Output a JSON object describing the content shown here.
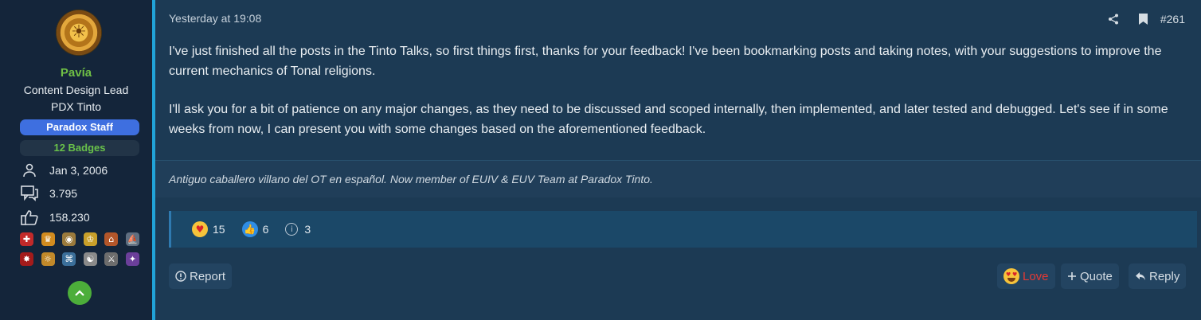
{
  "user": {
    "name": "Pavía",
    "title_line1": "Content Design Lead",
    "title_line2": "PDX Tinto",
    "staff_badge": "Paradox Staff",
    "badges": "12 Badges",
    "stats": [
      {
        "icon": "person-icon",
        "value": "Jan 3, 2006"
      },
      {
        "icon": "messages-icon",
        "value": "3.795"
      },
      {
        "icon": "thumbs-up-icon",
        "value": "158.230"
      }
    ],
    "trophy_icons": [
      "crusader-shield-icon",
      "crown-gold-icon",
      "coin-seal-icon",
      "crowns-icon",
      "castle-icon",
      "ship-icon",
      "dragon-icon",
      "sun-seal-icon",
      "temple-icon",
      "yin-yang-icon",
      "sword-icon",
      "dark-sigil-icon"
    ]
  },
  "post": {
    "date": "Yesterday at 19:08",
    "number": "#261",
    "paragraphs": [
      "I've just finished all the posts in the Tinto Talks, so first things first, thanks for your feedback! I've been bookmarking posts and taking notes, with your suggestions to improve the current mechanics of Tonal religions.",
      "I'll ask you for a bit of patience on any major changes, as they need to be discussed and scoped internally, then implemented, and later tested and debugged. Let's see if in some weeks from now, I can present you with some changes based on the aforementioned feedback."
    ],
    "signature": "Antiguo caballero villano del OT en español. Now member of EUIV & EUV Team at Paradox Tinto."
  },
  "reactions": [
    {
      "icon": "love-emoji-icon",
      "count": "15"
    },
    {
      "icon": "like-icon",
      "count": "6"
    },
    {
      "icon": "info-icon",
      "count": "3"
    }
  ],
  "actions": {
    "report": "Report",
    "love": "Love",
    "quote": "Quote",
    "reply": "Reply"
  },
  "colors": {
    "accent": "#21a3d8",
    "username": "#6fbf45",
    "staff_badge": "#3e6fe0",
    "love": "#e53935"
  }
}
